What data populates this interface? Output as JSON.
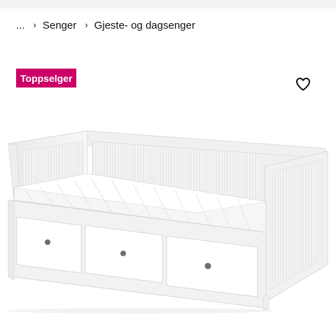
{
  "breadcrumb": {
    "ellipsis": "...",
    "items": [
      "Senger",
      "Gjeste- og dagsenger"
    ],
    "separator": "›"
  },
  "badge": {
    "label": "Toppselger",
    "color": "#cc0066"
  },
  "favorite": {
    "icon": "heart-icon"
  },
  "product": {
    "image_icon": "daybed-image"
  }
}
